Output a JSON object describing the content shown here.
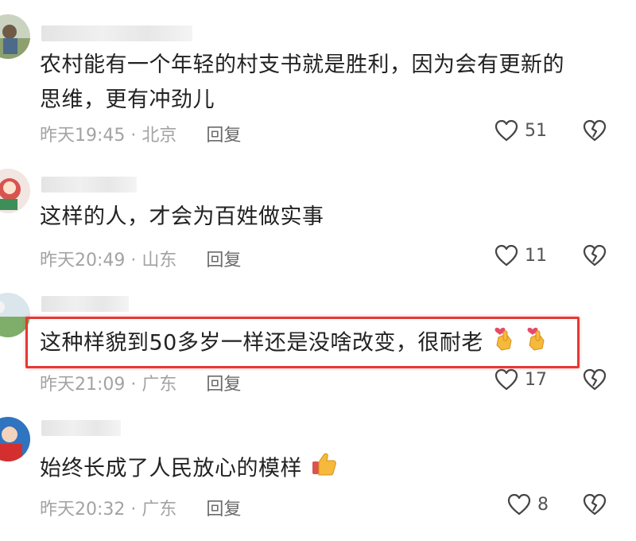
{
  "comments": [
    {
      "text_line1": "农村能有一个年轻的村支书就是胜利，因为会有更新的",
      "text_line2": "思维，更有冲劲儿",
      "time_location": "昨天19:45 · 北京",
      "reply_label": "回复",
      "likes": "51"
    },
    {
      "text_line1": "这样的人，才会为百姓做实事",
      "time_location": "昨天20:49 · 山东",
      "reply_label": "回复",
      "likes": "11"
    },
    {
      "text_line1": "这种样貌到50多岁一样还是没啥改变，很耐老",
      "time_location": "昨天21:09 · 广东",
      "reply_label": "回复",
      "likes": "17"
    },
    {
      "text_line1": "始终长成了人民放心的模样",
      "time_location": "昨天20:32 · 广东",
      "reply_label": "回复",
      "likes": "8"
    }
  ],
  "icons": {
    "like": "heart-outline-icon",
    "dislike": "broken-heart-icon",
    "finger_heart": "finger-heart-emoji",
    "thumbs_up": "thumbs-up-emoji"
  },
  "colors": {
    "highlight_border": "#e53935",
    "meta_text": "#a3a3a3",
    "reply_text": "#6b6b6b"
  }
}
